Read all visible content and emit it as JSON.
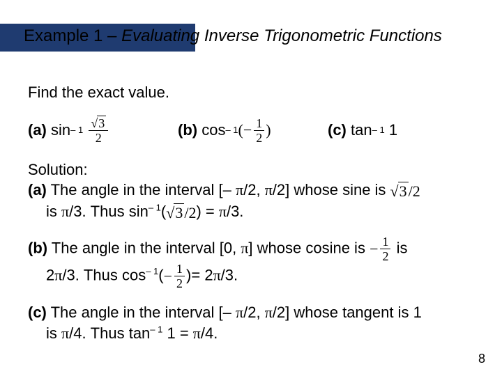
{
  "title": {
    "example": "Example 1",
    "dash": " – ",
    "subtitle": "Evaluating Inverse Trigonometric Functions"
  },
  "prompt": "Find the exact value.",
  "problems": {
    "a": {
      "label": "(a)",
      "fn": "sin",
      "exp": "– 1",
      "arg_num": "3",
      "arg_den": "2"
    },
    "b": {
      "label": "(b)",
      "fn": "cos",
      "exp": "– 1",
      "arg_num": "1",
      "arg_den": "2",
      "neg": true
    },
    "c": {
      "label": "(c)",
      "fn": "tan",
      "exp": "– 1",
      "arg": "1"
    }
  },
  "solution": {
    "heading": "Solution:",
    "a": {
      "label": "(a)",
      "line1_pre": " The angle in the interval [– ",
      "line1_mid": "/2, ",
      "line1_post": "/2] whose sine is ",
      "line2_pre": "is ",
      "line2_mid": "/3. Thus sin",
      "line2_exp": "– 1",
      "line2_open": "(",
      "line2_close_eq": ") = ",
      "line2_end": "/3."
    },
    "b": {
      "label": "(b)",
      "line1_pre": " The angle in the interval [0, ",
      "line1_post": "] whose cosine is ",
      "line1_end": " is",
      "line2_pre": "2",
      "line2_mid": "/3. Thus cos",
      "line2_exp": "– 1",
      "line2_open": "(",
      "line2_close_eq": ")= 2",
      "line2_end": "/3."
    },
    "c": {
      "label": "(c)",
      "line1_pre": " The angle in the interval [– ",
      "line1_mid": "/2, ",
      "line1_post": "/2] whose tangent is 1",
      "line2_pre": "is ",
      "line2_mid": "/4. Thus tan",
      "line2_exp": "– 1",
      "line2_arg": " 1 = ",
      "line2_end": "/4."
    }
  },
  "page": "8",
  "glyphs": {
    "pi": "π",
    "sqrt3": "3",
    "sqrt3over2_num": "3",
    "sqrt3over2_den": "2",
    "neghalf_num": "1",
    "neghalf_den": "2"
  }
}
